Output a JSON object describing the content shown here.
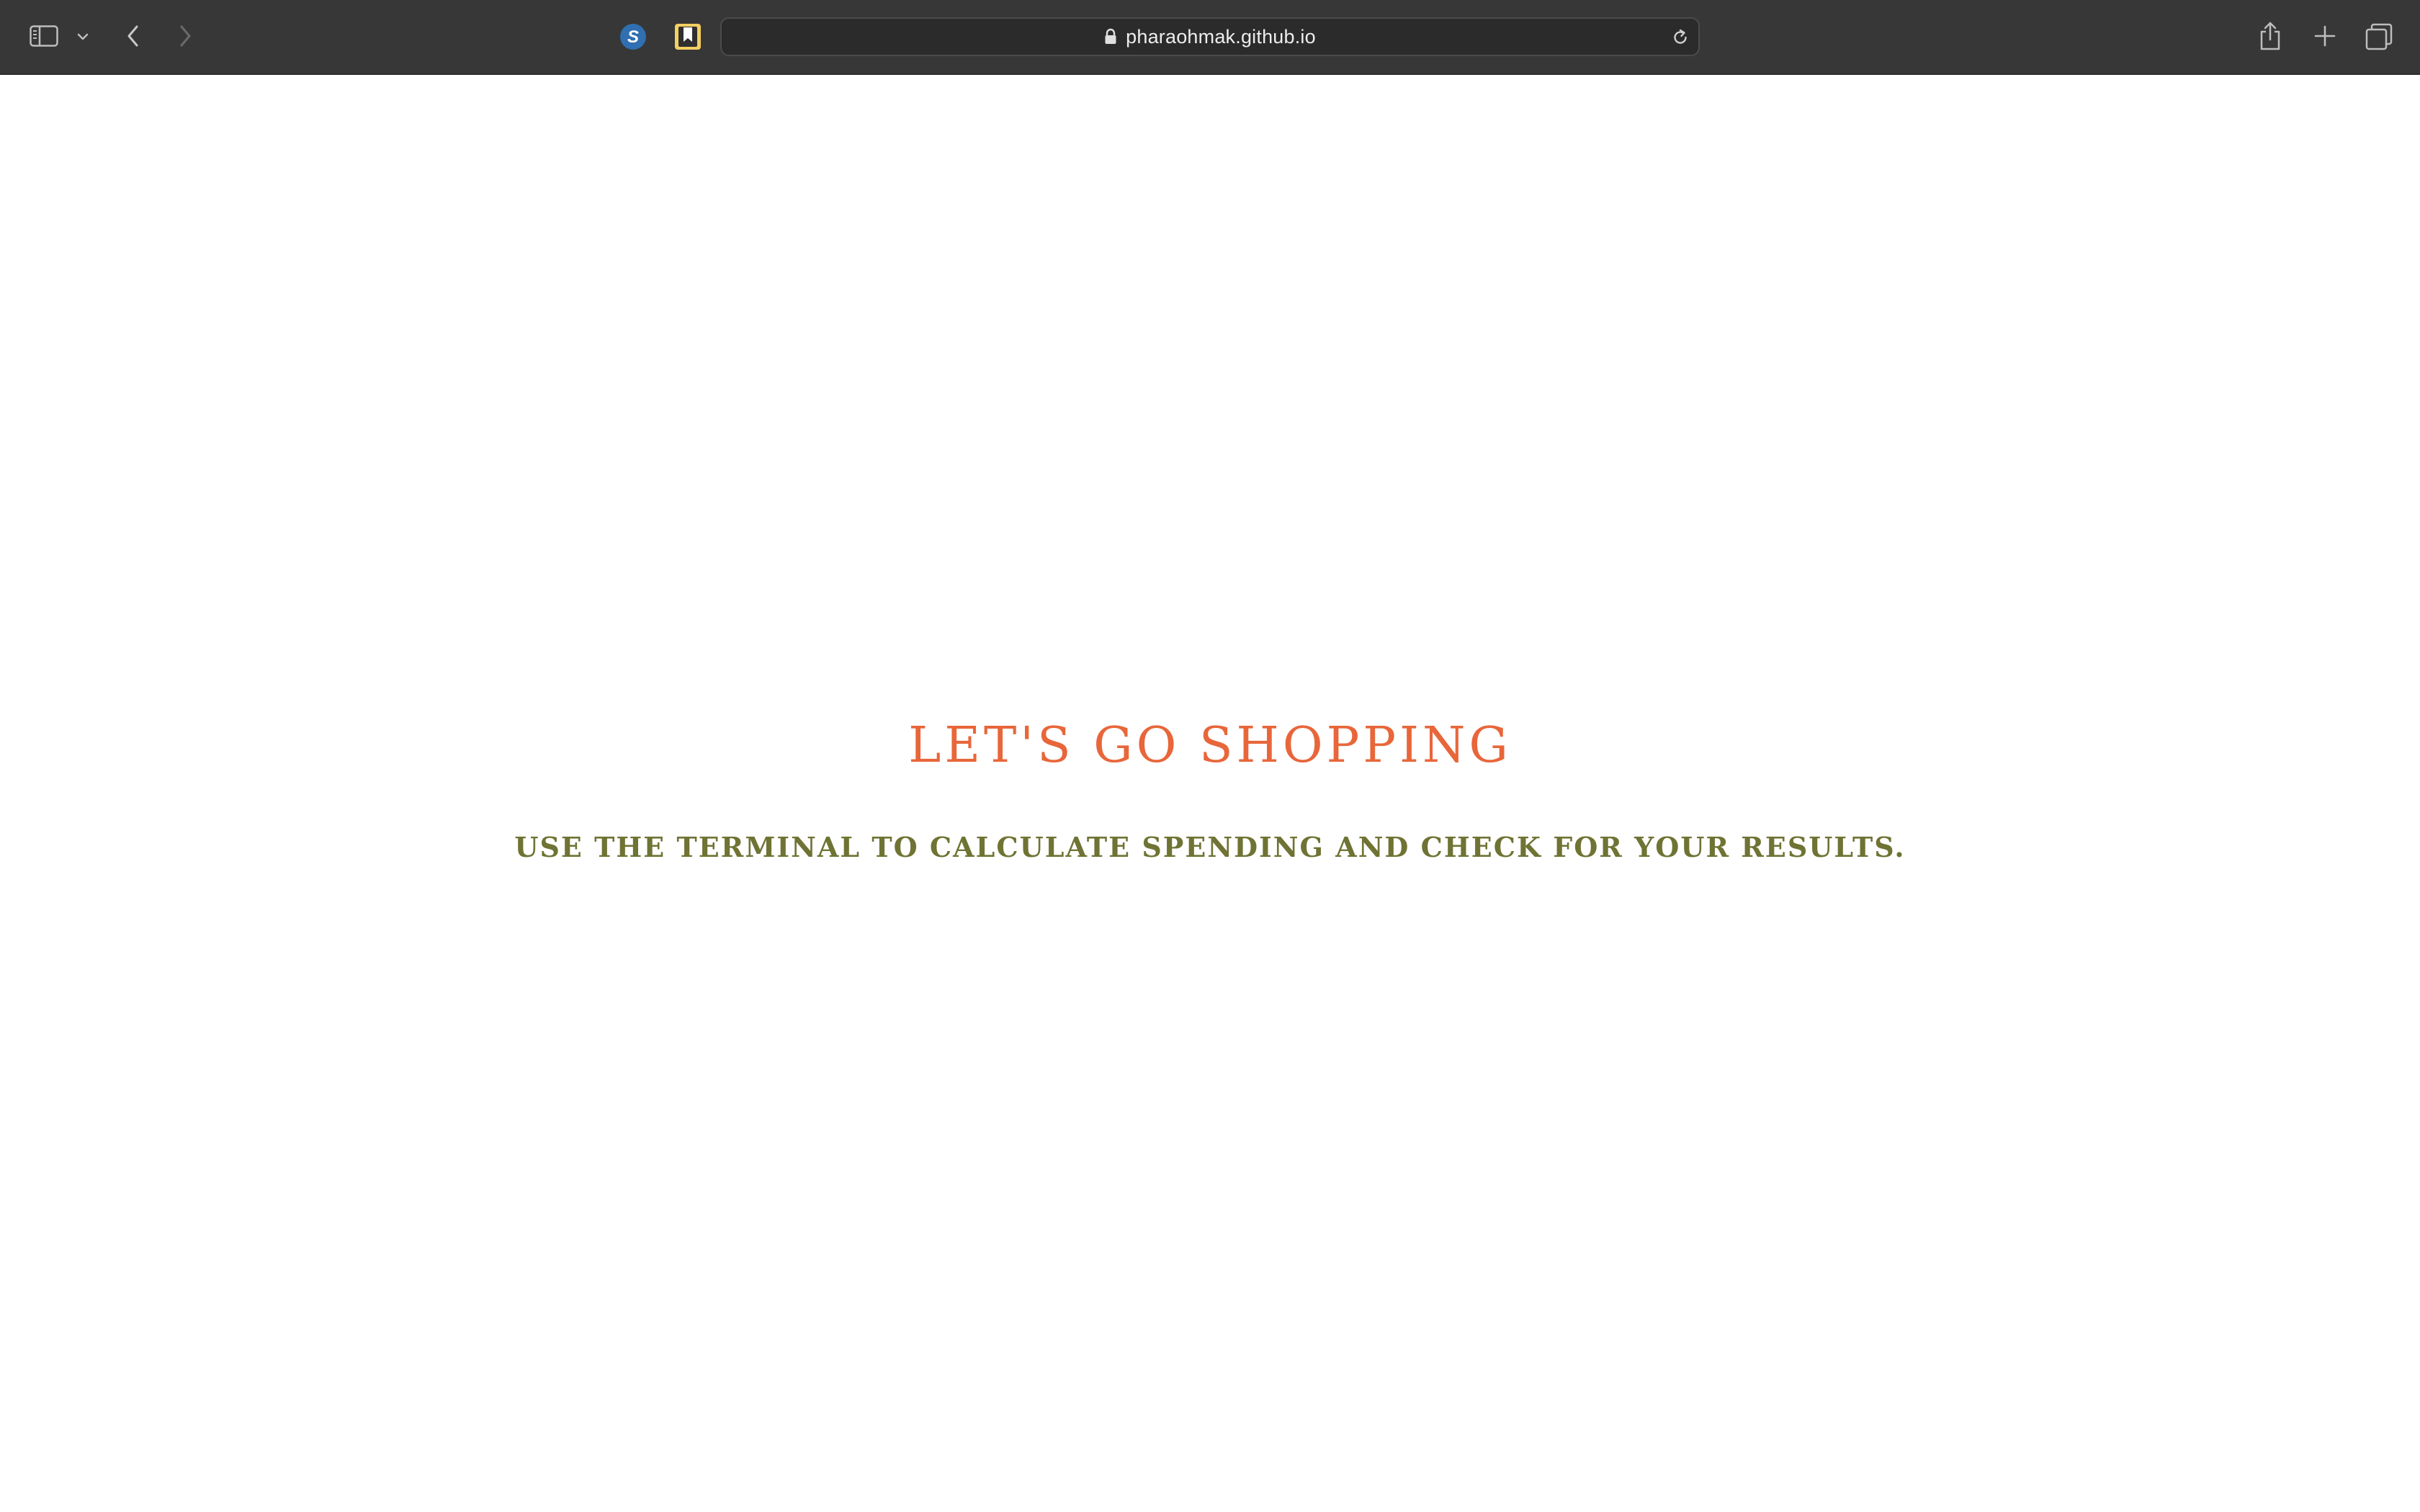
{
  "browser": {
    "url": "pharaohmak.github.io",
    "icons": {
      "sidebar": "sidebar-icon",
      "sidebar_menu": "chevron-down-icon",
      "back": "chevron-left-icon",
      "forward": "chevron-right-icon",
      "extension_s": "s-extension-icon",
      "extension_bookmark": "bookmark-extension-icon",
      "lock": "lock-icon",
      "reload": "reload-icon",
      "share": "share-icon",
      "new_tab": "plus-icon",
      "tab_overview": "tabs-icon"
    },
    "colors": {
      "toolbar": "#373737",
      "address_bar": "#2b2b2b"
    }
  },
  "page": {
    "title": "LET'S GO SHOPPING",
    "subtitle": "USE THE TERMINAL TO CALCULATE SPENDING AND CHECK FOR YOUR RESULTS.",
    "colors": {
      "title": "#e8663a",
      "subtitle": "#6f7333",
      "background": "#ffffff"
    }
  }
}
